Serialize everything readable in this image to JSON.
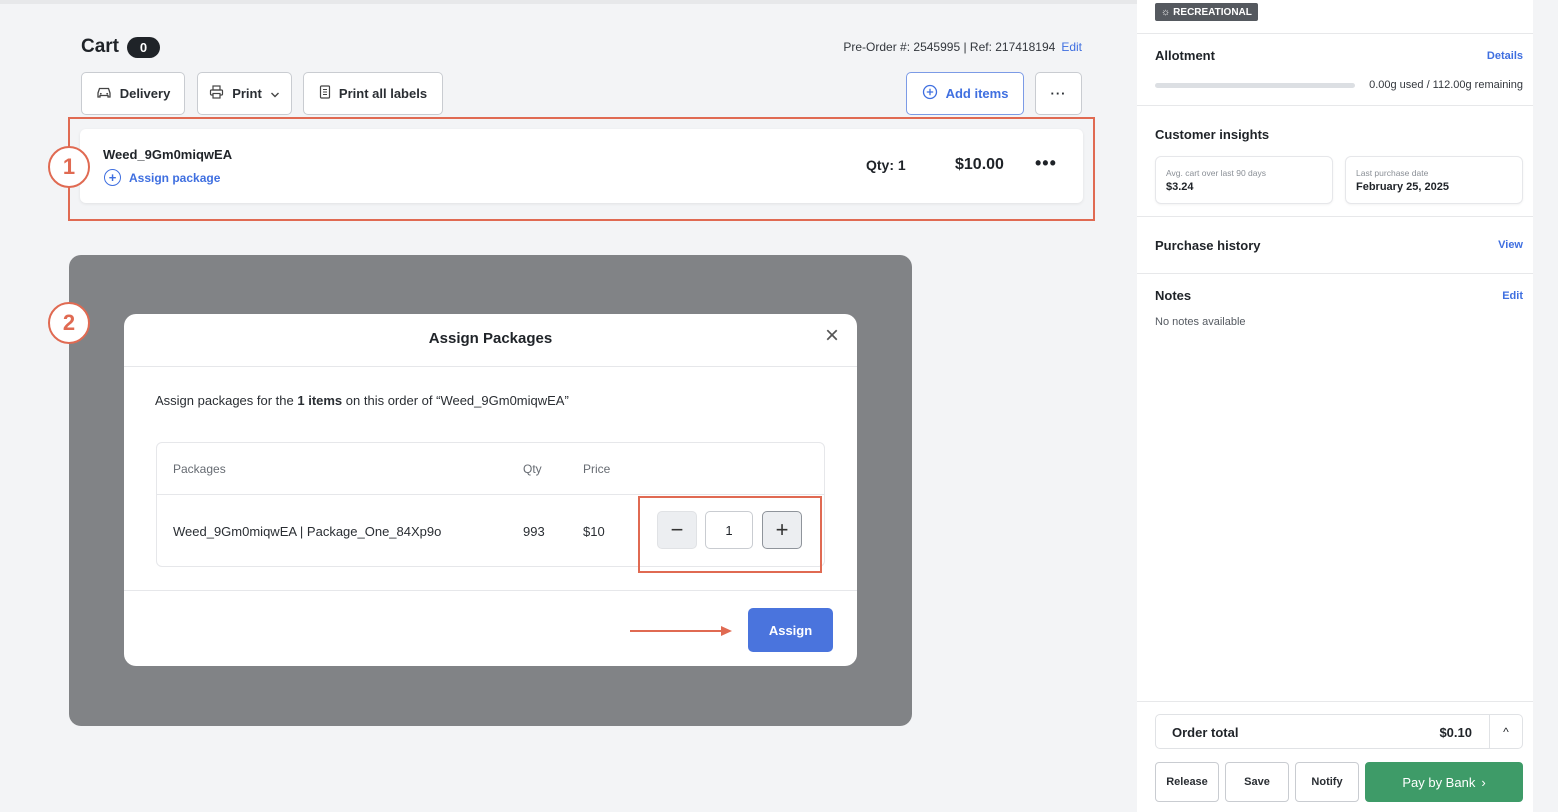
{
  "cart": {
    "title": "Cart",
    "count": "0",
    "pre_order_label": "Pre-Order #: 2545995 | Ref: 217418194",
    "edit_label": "Edit"
  },
  "toolbar": {
    "delivery_label": "Delivery",
    "print_label": "Print",
    "print_all_label": "Print all labels",
    "add_items_label": "Add items",
    "more_label": "···"
  },
  "item": {
    "name": "Weed_9Gm0miqwEA",
    "assign_package_label": "Assign package",
    "qty": "Qty: 1",
    "price": "$10.00",
    "menu": "•••"
  },
  "steps": {
    "one": "1",
    "two": "2"
  },
  "modal": {
    "title": "Assign Packages",
    "close": "×",
    "desc_prefix": "Assign packages for the ",
    "desc_bold": "1 items",
    "desc_suffix": " on this order of “Weed_9Gm0miqwEA”",
    "columns": {
      "packages": "Packages",
      "qty": "Qty",
      "price": "Price"
    },
    "row": {
      "name": "Weed_9Gm0miqwEA | Package_One_84Xp9o",
      "qty": "993",
      "price": "$10"
    },
    "stepper": {
      "minus": "−",
      "value": "1",
      "plus": "+"
    },
    "assign_label": "Assign"
  },
  "sidebar": {
    "badge": "RECREATIONAL",
    "allotment": {
      "title": "Allotment",
      "details_label": "Details",
      "usage": "0.00g used / 112.00g remaining",
      "used_fraction": 0
    },
    "insights": {
      "title": "Customer insights",
      "avg_label": "Avg. cart over last 90 days",
      "avg_value": "$3.24",
      "last_label": "Last purchase date",
      "last_value": "February 25, 2025"
    },
    "history": {
      "title": "Purchase history",
      "view_label": "View"
    },
    "notes": {
      "title": "Notes",
      "edit_label": "Edit",
      "empty": "No notes available"
    },
    "total": {
      "label": "Order total",
      "value": "$0.10",
      "toggle": "^"
    },
    "actions": {
      "release": "Release",
      "save": "Save",
      "notify": "Notify",
      "pay": "Pay by Bank",
      "pay_chevron": "›"
    }
  },
  "colors": {
    "accent": "#3f6fe0",
    "annotation": "#e06a52",
    "pay_button": "#3e9b68"
  }
}
